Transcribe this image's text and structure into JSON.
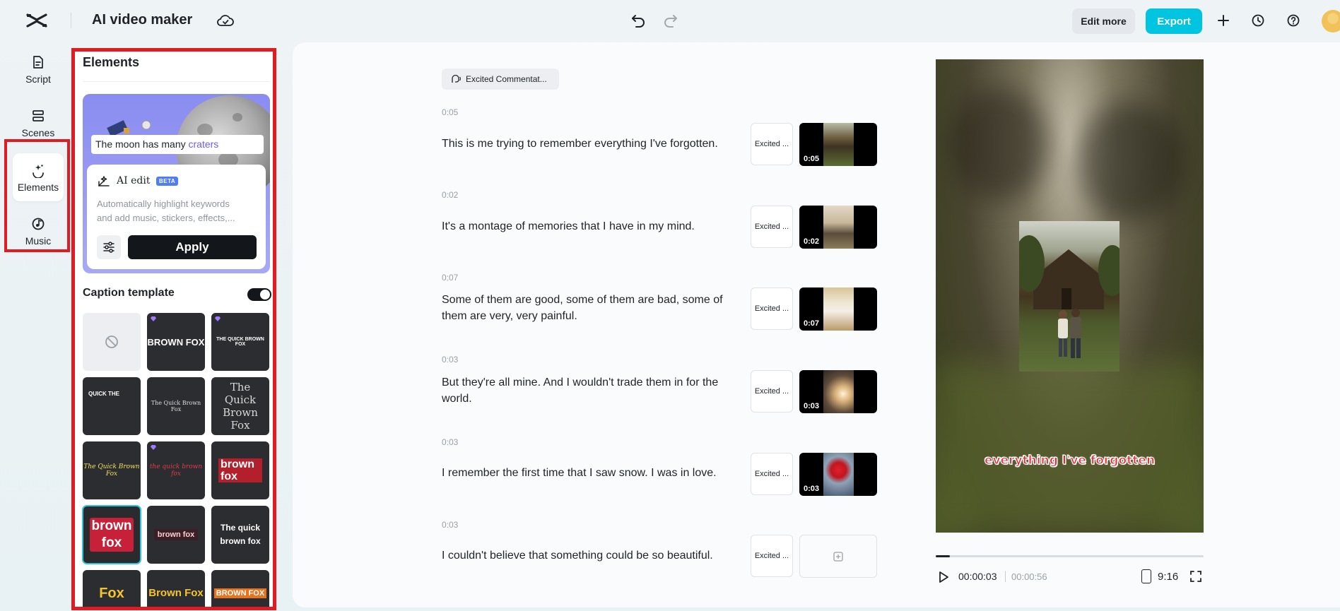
{
  "header": {
    "app_title": "AI video maker",
    "edit_more_label": "Edit more",
    "export_label": "Export"
  },
  "sidebar": {
    "items": [
      {
        "label": "Script",
        "icon": "script-icon"
      },
      {
        "label": "Scenes",
        "icon": "scenes-icon"
      },
      {
        "label": "Elements",
        "icon": "elements-icon",
        "active": true
      },
      {
        "label": "Music",
        "icon": "music-icon"
      }
    ]
  },
  "elements_panel": {
    "title": "Elements",
    "ai_card": {
      "caption_text": "The moon has many ",
      "caption_highlight": "craters",
      "ai_edit_label": "AI edit",
      "beta_badge": "BETA",
      "description_line1": "Automatically highlight keywords",
      "description_line2": "and add music, stickers, effects,...",
      "apply_label": "Apply"
    },
    "caption_template": {
      "title": "Caption template",
      "enabled": true,
      "templates": [
        {
          "label": ""
        },
        {
          "label": "BROWN FOX"
        },
        {
          "label": "THE QUICK BROWN FOX"
        },
        {
          "label": "QUICK THE"
        },
        {
          "label": "The Quick Brown Fox"
        },
        {
          "label": "The Quick Brown Fox"
        },
        {
          "label": "The Quick Brown Fox"
        },
        {
          "label": "the quick brown fox"
        },
        {
          "label": "brown fox"
        },
        {
          "label": "brown fox"
        },
        {
          "label": "brown fox"
        },
        {
          "label": "The quick brown fox"
        },
        {
          "label": "Fox"
        },
        {
          "label": "Brown Fox"
        },
        {
          "label": "BROWN FOX"
        }
      ]
    }
  },
  "script": {
    "voice_chip_label": "Excited Commentat...",
    "voice_short_label": "Excited ...",
    "scenes": [
      {
        "time": "0:05",
        "text": "This is me trying to remember everything I've forgotten.",
        "thumb_duration": "0:05"
      },
      {
        "time": "0:02",
        "text": "It's a montage of memories that I have in my mind.",
        "thumb_duration": "0:02"
      },
      {
        "time": "0:07",
        "text": "Some of them are good, some of them are bad, some of them are very, very painful.",
        "thumb_duration": "0:07"
      },
      {
        "time": "0:03",
        "text": "But they're all mine. And I wouldn't trade them in for the world.",
        "thumb_duration": "0:03"
      },
      {
        "time": "0:03",
        "text": "I remember the first time that I saw snow. I was in love.",
        "thumb_duration": "0:03"
      },
      {
        "time": "0:03",
        "text": "I couldn't believe that something could be so beautiful.",
        "thumb_duration": ""
      }
    ]
  },
  "preview": {
    "caption": "everything I've forgotten",
    "current_time": "00:00:03",
    "total_time": "00:00:56",
    "progress_fraction": 0.054,
    "aspect_ratio": "9:16"
  }
}
